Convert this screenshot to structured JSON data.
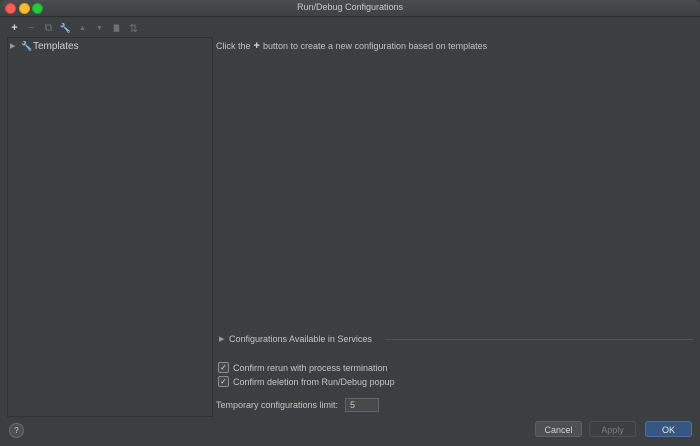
{
  "window": {
    "title": "Run/Debug Configurations"
  },
  "toolbar": {
    "add": "+",
    "remove": "−",
    "copy": "⧉",
    "edit_templates": "🔧",
    "move_up": "▲",
    "move_down": "▼",
    "folder": "▇",
    "sort": "⇅"
  },
  "tree": {
    "templates_label": "Templates"
  },
  "main": {
    "hint_before": "Click the",
    "hint_plus": "+",
    "hint_after": "button to create a new configuration based on templates"
  },
  "services": {
    "label": "Configurations Available in Services"
  },
  "options": {
    "confirm_rerun": "Confirm rerun with process termination",
    "confirm_deletion": "Confirm deletion from Run/Debug popup",
    "checkmark": "✓"
  },
  "limit": {
    "label": "Temporary configurations limit:",
    "value": "5"
  },
  "buttons": {
    "help": "?",
    "cancel": "Cancel",
    "apply": "Apply",
    "ok": "OK"
  }
}
